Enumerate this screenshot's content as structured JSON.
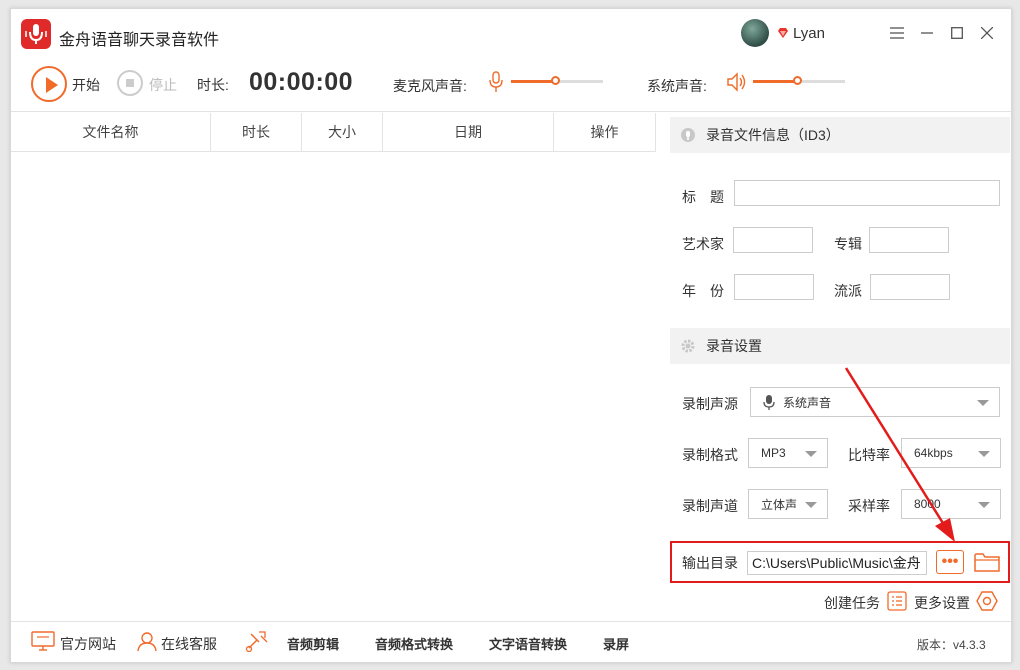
{
  "window": {
    "title": "金舟语音聊天录音软件",
    "username": "Lyan",
    "controls": [
      "minimize",
      "maximize",
      "close"
    ]
  },
  "toolbar": {
    "start_label": "开始",
    "stop_label": "停止",
    "duration_label": "时长:",
    "duration_value": "00:00:00",
    "mic_label": "麦克风声音:",
    "mic_level": 0.48,
    "system_label": "系统声音:",
    "system_level": 0.48
  },
  "table": {
    "columns": [
      "文件名称",
      "时长",
      "大小",
      "日期",
      "操作"
    ]
  },
  "id3": {
    "section_title": "录音文件信息（ID3）",
    "title_label": "标　题",
    "artist_label": "艺术家",
    "album_label": "专辑",
    "year_label": "年　份",
    "genre_label": "流派"
  },
  "settings": {
    "section_title": "录音设置",
    "source_label": "录制声源",
    "source_value": "系统声音",
    "format_label": "录制格式",
    "format_value": "MP3",
    "bitrate_label": "比特率",
    "bitrate_value": "64kbps",
    "channel_label": "录制声道",
    "channel_value": "立体声",
    "samplerate_label": "采样率",
    "samplerate_value": "8000",
    "output_label": "输出目录",
    "output_path": "C:\\Users\\Public\\Music\\金舟",
    "browse_label": "•••",
    "create_task_label": "创建任务",
    "more_settings_label": "更多设置"
  },
  "bottom_bar": {
    "website_label": "官方网站",
    "support_label": "在线客服",
    "audio_edit_label": "音频剪辑",
    "format_convert_label": "音频格式转换",
    "tts_label": "文字语音转换",
    "screen_record_label": "录屏",
    "version_label": "版本：v4.3.3"
  },
  "colors": {
    "accent": "#f06a2a",
    "highlight_box": "#e41b1b",
    "logo": "#e02a2a"
  }
}
